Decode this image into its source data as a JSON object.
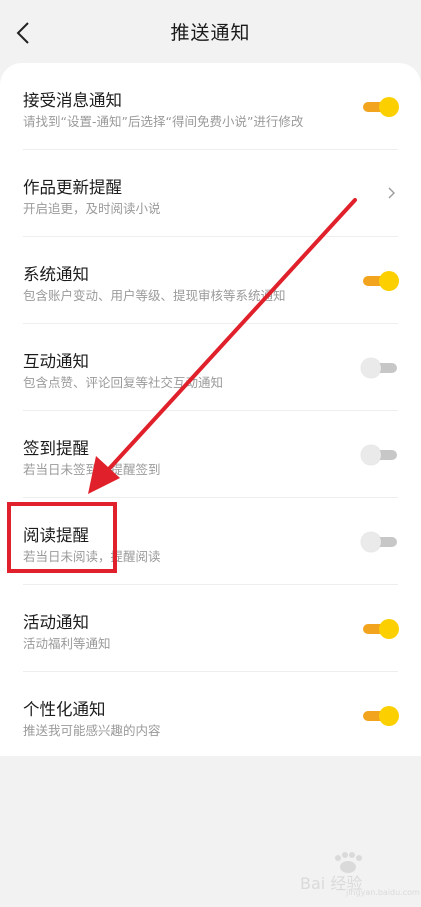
{
  "header": {
    "title": "推送通知"
  },
  "settings": [
    {
      "title": "接受消息通知",
      "desc": "请找到“设置-通知”后选择“得间免费小说”进行修改",
      "control": "toggle",
      "enabled": true
    },
    {
      "title": "作品更新提醒",
      "desc": "开启追更，及时阅读小说",
      "control": "chevron"
    },
    {
      "title": "系统通知",
      "desc": "包含账户变动、用户等级、提现审核等系统通知",
      "control": "toggle",
      "enabled": true
    },
    {
      "title": "互动通知",
      "desc": "包含点赞、评论回复等社交互动通知",
      "control": "toggle",
      "enabled": false
    },
    {
      "title": "签到提醒",
      "desc": "若当日未签到，提醒签到",
      "control": "toggle",
      "enabled": false
    },
    {
      "title": "阅读提醒",
      "desc": "若当日未阅读，提醒阅读",
      "control": "toggle",
      "enabled": false
    },
    {
      "title": "活动通知",
      "desc": "活动福利等通知",
      "control": "toggle",
      "enabled": true
    },
    {
      "title": "个性化通知",
      "desc": "推送我可能感兴趣的内容",
      "control": "toggle",
      "enabled": true
    }
  ],
  "colors": {
    "toggle_on_track": "#f3a41f",
    "toggle_on_knob": "#fcd000",
    "toggle_off_track": "#c7c7c7",
    "annotation": "#e0202a"
  },
  "watermark": {
    "text": "Bai 经验",
    "sub": "jingyan.baidu.com"
  }
}
